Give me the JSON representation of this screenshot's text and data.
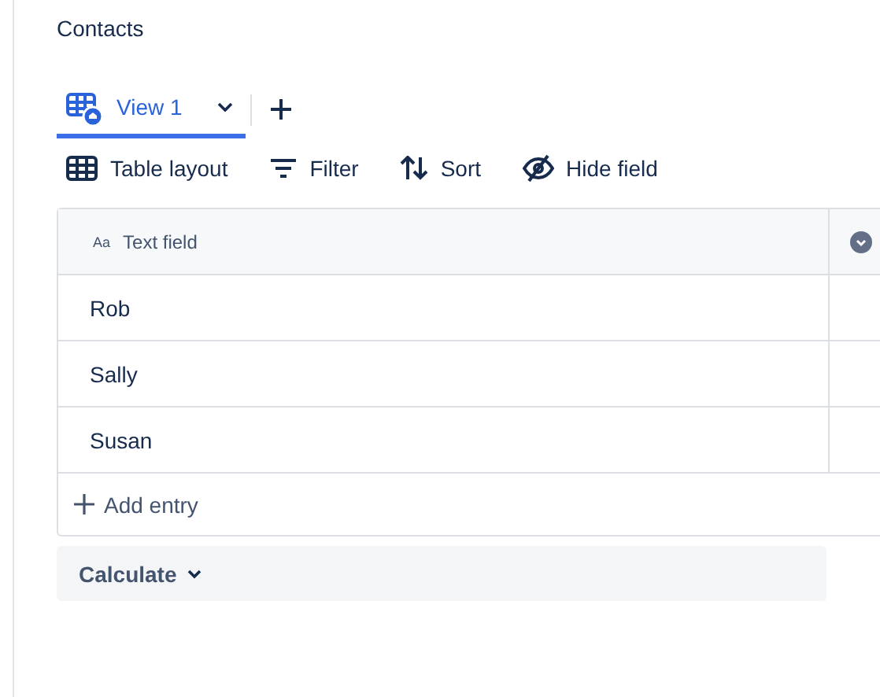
{
  "page_title": "Contacts",
  "views": [
    {
      "label": "View 1",
      "selected": true
    }
  ],
  "toolbar": [
    {
      "kind": "table",
      "label": "Table layout"
    },
    {
      "kind": "filter",
      "label": "Filter"
    },
    {
      "kind": "sort",
      "label": "Sort"
    },
    {
      "kind": "hide",
      "label": "Hide field"
    }
  ],
  "table": {
    "columns": [
      {
        "type_label": "Aa",
        "label": "Text field"
      }
    ],
    "rows": [
      {
        "cells": [
          "Rob"
        ]
      },
      {
        "cells": [
          "Sally"
        ]
      },
      {
        "cells": [
          "Susan"
        ]
      }
    ],
    "add_entry": "Add entry"
  },
  "calculate": "Calculate"
}
